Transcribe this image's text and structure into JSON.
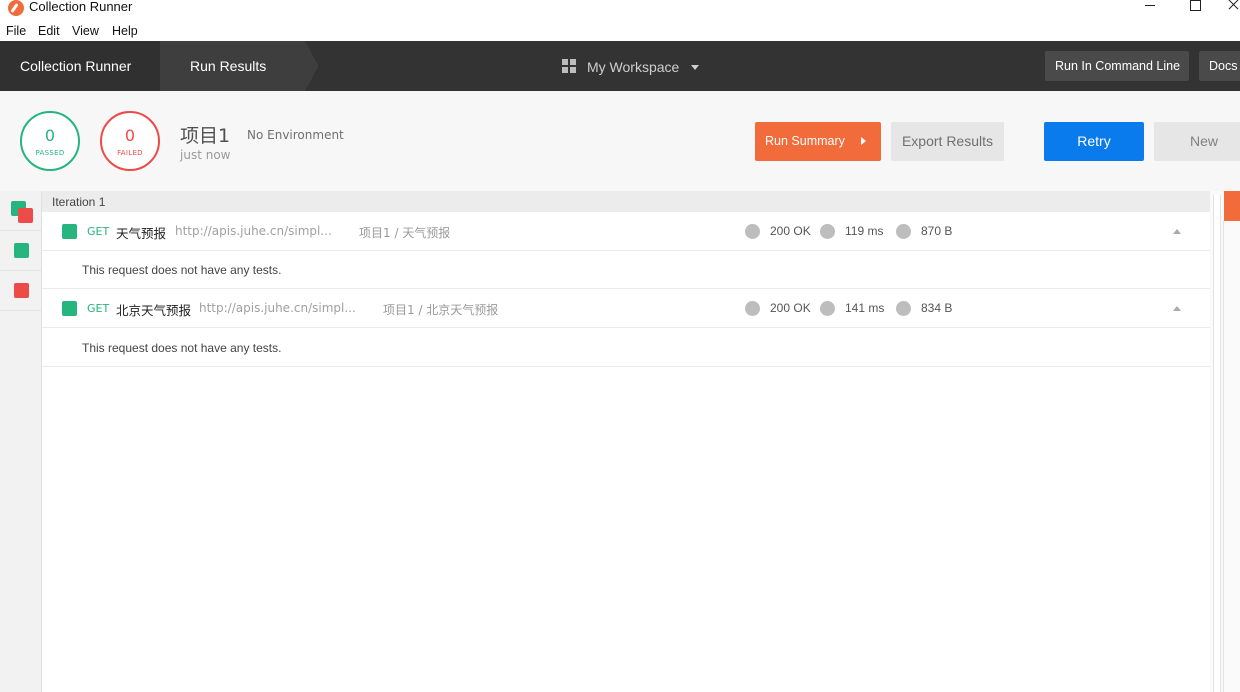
{
  "window": {
    "title": "Collection Runner"
  },
  "menu": [
    "File",
    "Edit",
    "View",
    "Help"
  ],
  "header": {
    "breadcrumb_1": "Collection Runner",
    "breadcrumb_2": "Run Results",
    "workspace": "My Workspace",
    "run_cmd_label": "Run In Command Line",
    "docs_label": "Docs"
  },
  "summary": {
    "passed_count": "0",
    "passed_label": "PASSED",
    "failed_count": "0",
    "failed_label": "FAILED",
    "collection_name": "项目1",
    "environment": "No Environment",
    "time": "just now",
    "run_summary_label": "Run Summary",
    "export_label": "Export Results",
    "retry_label": "Retry",
    "new_label": "New"
  },
  "iteration": {
    "label": "Iteration 1"
  },
  "requests": [
    {
      "method": "GET",
      "name": "天气预报",
      "url": "http://apis.juhe.cn/simpl...",
      "path": "项目1 / 天气预报",
      "status": "200 OK",
      "time": "119 ms",
      "size": "870 B",
      "note": "This request does not have any tests."
    },
    {
      "method": "GET",
      "name": "北京天气预报",
      "url": "http://apis.juhe.cn/simpl...",
      "path": "项目1 / 北京天气预报",
      "status": "200 OK",
      "time": "141 ms",
      "size": "834 B",
      "note": "This request does not have any tests."
    }
  ],
  "colors": {
    "pass": "#26b47f",
    "fail": "#ed4b48",
    "accent_orange": "#f26b3a",
    "accent_blue": "#097bed",
    "header_bg": "#333333"
  },
  "icons": {
    "app": "postman-logo-icon",
    "workspace": "grid-icon",
    "workspace_caret": "chevron-down-icon",
    "summary_caret": "chevron-right-icon",
    "collapse": "chevron-up-icon"
  }
}
